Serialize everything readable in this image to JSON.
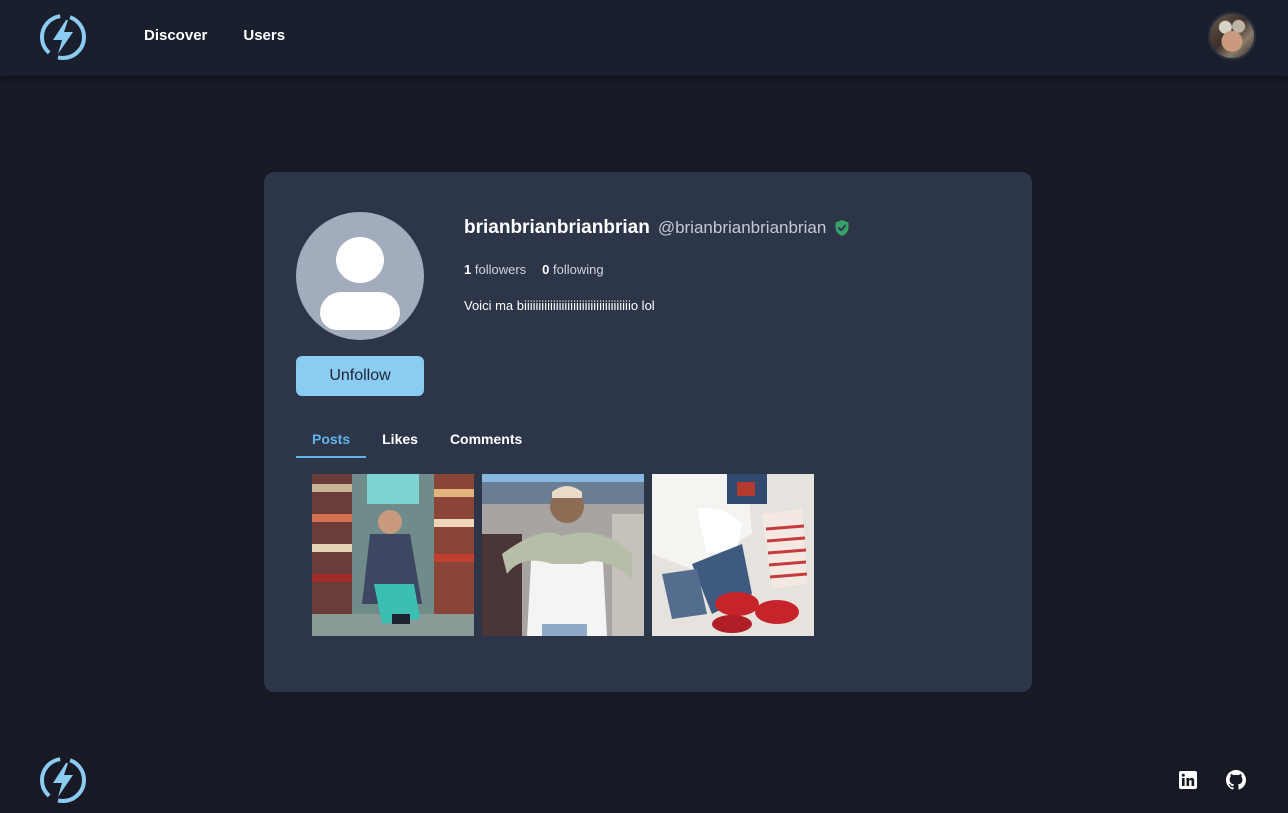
{
  "nav": {
    "items": [
      {
        "label": "Discover"
      },
      {
        "label": "Users"
      }
    ]
  },
  "profile": {
    "display_name": "brianbrianbrianbrian",
    "handle": "@brianbrianbrianbrian",
    "verified": true,
    "followers_count": "1",
    "followers_label": "followers",
    "following_count": "0",
    "following_label": "following",
    "bio": "Voici ma biiiiiiiiiiiiiiiiiiiiiiiiiiiiiiiiiiiiio lol",
    "follow_button_label": "Unfollow"
  },
  "tabs": [
    {
      "label": "Posts",
      "active": true
    },
    {
      "label": "Likes",
      "active": false
    },
    {
      "label": "Comments",
      "active": false
    }
  ],
  "posts": [
    {
      "description": "photo-post-1"
    },
    {
      "description": "photo-post-2"
    },
    {
      "description": "photo-post-3"
    }
  ],
  "colors": {
    "background": "#171a25",
    "header": "#1a1f2d",
    "card": "#2d3548",
    "accent": "#63b3ed",
    "button": "#8ccbf2",
    "verified": "#38a169"
  },
  "icons": {
    "logo": "lightning-bolt-icon",
    "verified": "shield-check-icon",
    "linkedin": "linkedin-icon",
    "github": "github-icon"
  }
}
